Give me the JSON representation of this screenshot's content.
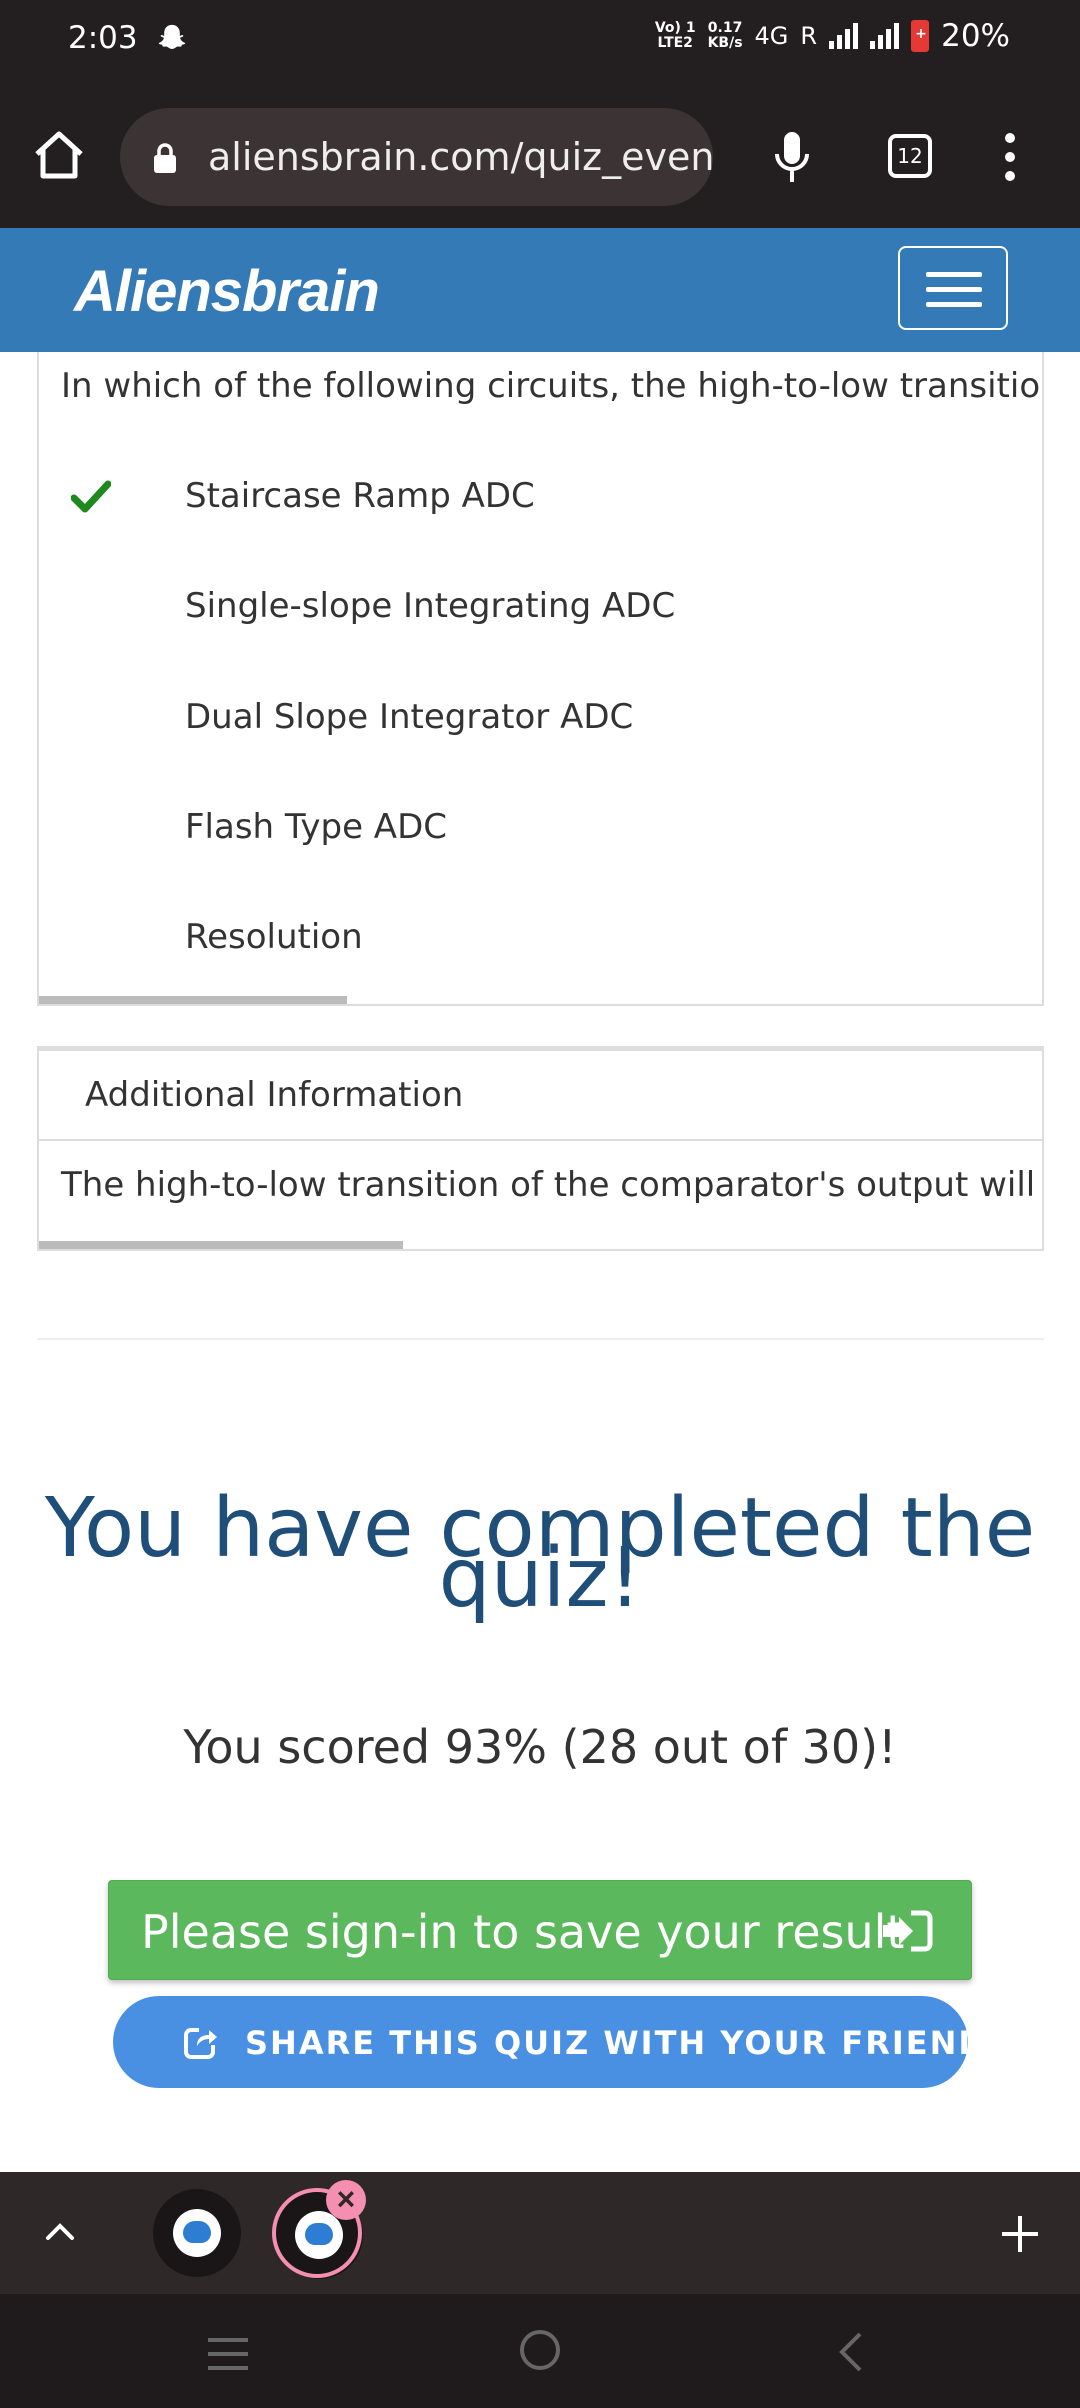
{
  "status_bar": {
    "time": "2:03",
    "volte_top": "Vo) 1",
    "volte_bottom": "LTE2",
    "speed_value": "0.17",
    "speed_unit": "KB/s",
    "network": "4G",
    "roaming": "R",
    "battery": "20%"
  },
  "browser": {
    "url": "aliensbrain.com/quiz_event",
    "tab_count": "12"
  },
  "site": {
    "brand": "Aliensbrain"
  },
  "question": {
    "text": "In which of the following circuits, the high-to-low transition of the",
    "options": [
      {
        "label": "Staircase Ramp ADC",
        "correct": true
      },
      {
        "label": "Single-slope Integrating ADC",
        "correct": false
      },
      {
        "label": "Dual Slope Integrator ADC",
        "correct": false
      },
      {
        "label": "Flash Type ADC",
        "correct": false
      },
      {
        "label": "Resolution",
        "correct": false
      }
    ]
  },
  "additional_info": {
    "title": "Additional Information",
    "body": "The high-to-low transition of the comparator's output will cause th"
  },
  "result": {
    "title_line1": "You have completed the",
    "title_line2": "quiz!",
    "score": "You scored 93% (28 out of 30)!",
    "signin_label": "Please sign-in to save your result",
    "share_label": "SHARE THIS QUIZ WITH YOUR FRIENDS"
  },
  "colors": {
    "header_blue": "#337ab7",
    "signin_green": "#5cb85c",
    "share_blue": "#4a90e2",
    "title_navy": "#1f4e79",
    "check_green": "#1e8a1e"
  },
  "icons": [
    "home-icon",
    "lock-icon",
    "mic-icon",
    "more-icon",
    "hamburger-icon",
    "check-icon",
    "sign-in-icon",
    "share-icon",
    "chevron-up-icon",
    "plus-icon",
    "close-icon"
  ]
}
